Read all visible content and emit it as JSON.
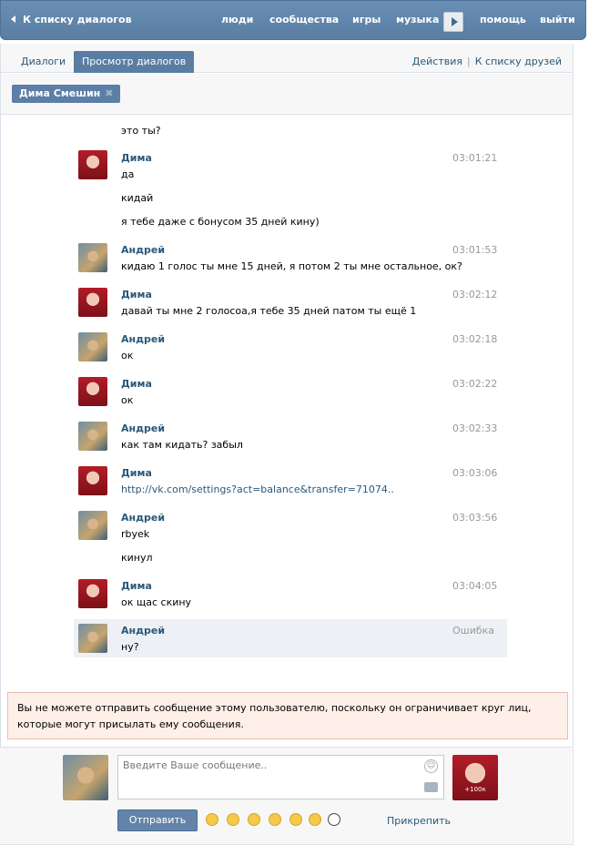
{
  "topbar": {
    "back_label": "К списку диалогов",
    "nav": [
      "люди",
      "сообщества",
      "игры",
      "музыка",
      "помощь",
      "выйти"
    ]
  },
  "tabs": {
    "dialogs": "Диалоги",
    "view": "Просмотр диалогов",
    "actions": "Действия",
    "friends": "К списку друзей"
  },
  "chip": {
    "name": "Дима Смешин"
  },
  "messages": [
    {
      "text": "это ты?"
    },
    {
      "name": "Дима",
      "time": "03:01:21",
      "text": "да"
    },
    {
      "text": "кидай"
    },
    {
      "text": "я тебе даже с бонусом 35 дней кину)"
    },
    {
      "name": "Андрей",
      "time": "03:01:53",
      "text": "кидаю 1 голос ты мне 15 дней, я потом 2 ты мне остальное, ок?"
    },
    {
      "name": "Дима",
      "time": "03:02:12",
      "text": "давай ты мне 2 голосоа,я тебе 35 дней патом ты ещё 1"
    },
    {
      "name": "Андрей",
      "time": "03:02:18",
      "text": "ок"
    },
    {
      "name": "Дима",
      "time": "03:02:22",
      "text": "ок"
    },
    {
      "name": "Андрей",
      "time": "03:02:33",
      "text": "как там кидать? забыл"
    },
    {
      "name": "Дима",
      "time": "03:03:06",
      "text": "http://vk.com/settings?act=balance&transfer=71074.."
    },
    {
      "name": "Андрей",
      "time": "03:03:56",
      "text": "rbyek"
    },
    {
      "text": "кинул"
    },
    {
      "name": "Дима",
      "time": "03:04:05",
      "text": "ок щас скину"
    },
    {
      "name": "Андрей",
      "time": "Ошибка",
      "text": "ну?"
    }
  ],
  "notice": "Вы не можете отправить сообщение этому пользователю, поскольку он ограничивает круг лиц, которые могут присылать ему сообщения.",
  "composer": {
    "placeholder": "Введите Ваше сообщение..",
    "send": "Отправить",
    "attach": "Прикрепить",
    "avatar_caption": "+100к"
  },
  "colors": {
    "accent": "#597da3",
    "link": "#2b587a",
    "notice_bg": "#ffefe9"
  }
}
